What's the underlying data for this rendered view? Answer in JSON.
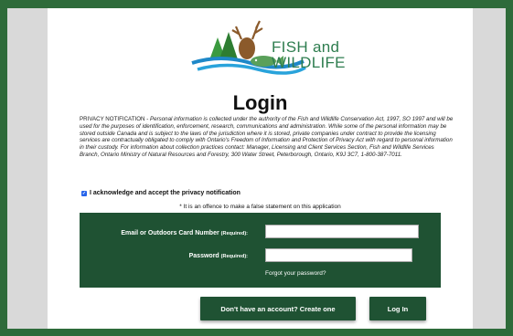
{
  "logo": {
    "line1": "FISH and",
    "line2": "WILDLIFE"
  },
  "page": {
    "title": "Login"
  },
  "privacy": {
    "lead": "PRIVACY NOTIFICATION - ",
    "text": "Personal information is collected under the authority of the Fish and Wildlife Conservation Act, 1997, SO 1997 and will be used for the purposes of identification, enforcement, research, communications and administration. While some of the personal information may be stored outside Canada and is subject to the laws of the jurisdiction where it is stored, private companies under contract to provide the licensing services are contractually obligated to comply with Ontario's Freedom of Information and Protection of Privacy Act with regard to personal information in their custody. For information about collection practices contact: Manager, Licensing and Client Services Section, Fish and Wildlife Services Branch, Ontario Ministry of Natural Resources and Forestry, 300 Water Street, Peterborough, Ontario, K9J 3C7, 1-800-387-7011."
  },
  "acknowledge": {
    "label": "I acknowledge and accept the privacy notification",
    "checked": true
  },
  "offence_note": "* It is an offence to make a false statement on this application",
  "form": {
    "email_label": "Email or Outdoors Card Number",
    "email_required": "(Required):",
    "email_value": "",
    "password_label": "Password",
    "password_required": "(Required):",
    "password_value": "",
    "forgot_link": "Forgot your password?"
  },
  "buttons": {
    "create_account": "Don't have an account? Create one",
    "login": "Log In"
  },
  "colors": {
    "brand_green": "#1f5233",
    "frame_green": "#2e6b3a",
    "logo_green": "#2e7d4f",
    "logo_blue": "#1e88c8"
  }
}
